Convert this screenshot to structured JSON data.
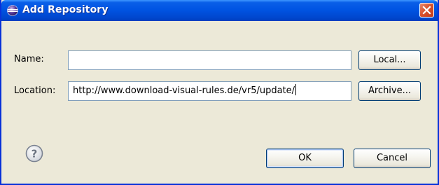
{
  "dialog": {
    "title": "Add Repository",
    "title_icon": "eclipse-icon",
    "close_icon": "close-icon"
  },
  "form": {
    "name_label": "Name:",
    "name_value": "",
    "location_label": "Location:",
    "location_value": "http://www.download-visual-rules.de/vr5/update/",
    "local_button": "Local...",
    "archive_button": "Archive..."
  },
  "footer": {
    "help_icon": "help-icon",
    "ok_button": "OK",
    "cancel_button": "Cancel"
  },
  "colors": {
    "titlebar": "#0054e3",
    "dialog_bg": "#ece9d8",
    "field_border": "#7f9db9",
    "button_border": "#003c74",
    "close_button": "#d8532f"
  }
}
